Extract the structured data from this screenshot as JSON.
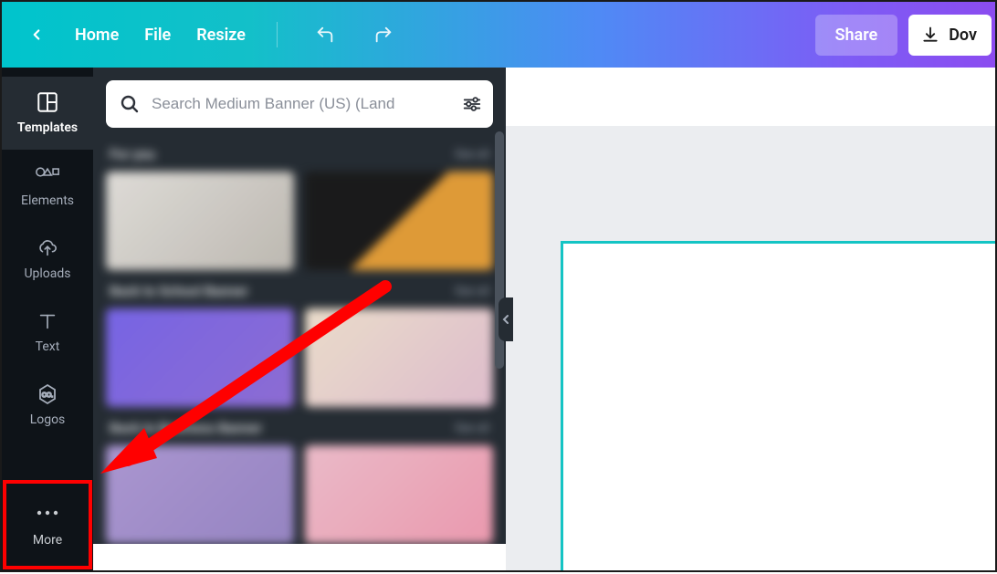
{
  "topbar": {
    "home": "Home",
    "file": "File",
    "resize": "Resize",
    "share": "Share",
    "download": "Dov"
  },
  "rail": {
    "templates": "Templates",
    "elements": "Elements",
    "uploads": "Uploads",
    "text": "Text",
    "logos": "Logos",
    "more": "More"
  },
  "search": {
    "placeholder": "Search Medium Banner (US) (Land"
  },
  "panel": {
    "sections": [
      {
        "title": "For you",
        "more": "See all"
      },
      {
        "title": "Back to School Banner",
        "more": "See all"
      },
      {
        "title": "Back to Business Banner",
        "more": "See all"
      }
    ]
  },
  "colors": {
    "highlight": "#ff0000",
    "teal": "#14c4c4"
  }
}
